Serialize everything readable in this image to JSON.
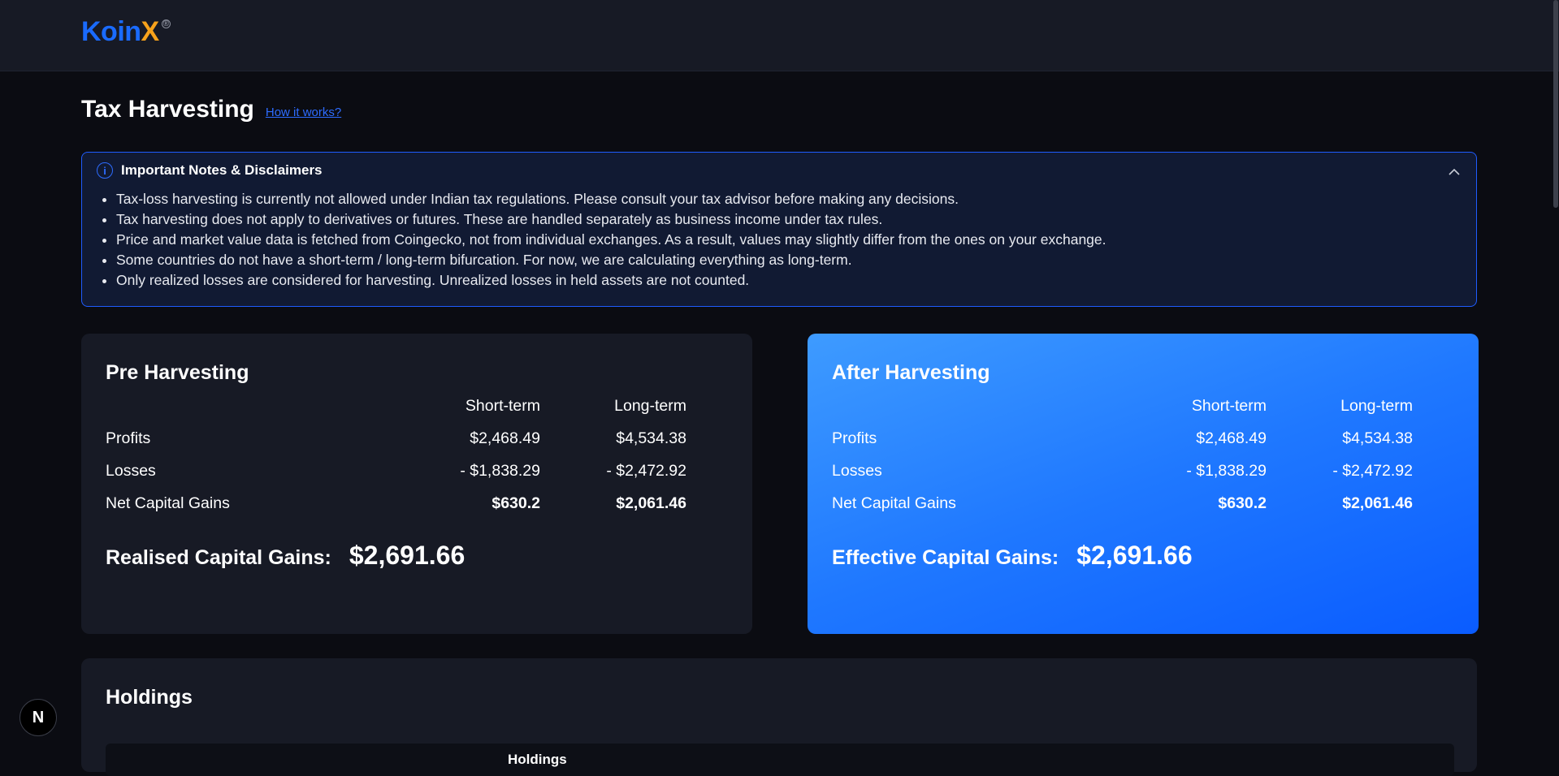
{
  "header": {
    "logo_main": "Koin",
    "logo_accent": "X",
    "logo_mark": "®"
  },
  "page": {
    "title": "Tax Harvesting",
    "how_link": "How it works?"
  },
  "notes": {
    "title": "Important Notes & Disclaimers",
    "items": [
      "Tax-loss harvesting is currently not allowed under Indian tax regulations. Please consult your tax advisor before making any decisions.",
      "Tax harvesting does not apply to derivatives or futures. These are handled separately as business income under tax rules.",
      "Price and market value data is fetched from Coingecko, not from individual exchanges. As a result, values may slightly differ from the ones on your exchange.",
      "Some countries do not have a short-term / long-term bifurcation. For now, we are calculating everything as long-term.",
      "Only realized losses are considered for harvesting. Unrealized losses in held assets are not counted."
    ]
  },
  "pre": {
    "title": "Pre Harvesting",
    "col_short": "Short-term",
    "col_long": "Long-term",
    "profits_label": "Profits",
    "profits_short": "$2,468.49",
    "profits_long": "$4,534.38",
    "losses_label": "Losses",
    "losses_short": "- $1,838.29",
    "losses_long": "- $2,472.92",
    "net_label": "Net Capital Gains",
    "net_short": "$630.2",
    "net_long": "$2,061.46",
    "total_label": "Realised Capital Gains:",
    "total_value": "$2,691.66"
  },
  "post": {
    "title": "After Harvesting",
    "col_short": "Short-term",
    "col_long": "Long-term",
    "profits_label": "Profits",
    "profits_short": "$2,468.49",
    "profits_long": "$4,534.38",
    "losses_label": "Losses",
    "losses_short": "- $1,838.29",
    "losses_long": "- $2,472.92",
    "net_label": "Net Capital Gains",
    "net_short": "$630.2",
    "net_long": "$2,061.46",
    "total_label": "Effective Capital Gains:",
    "total_value": "$2,691.66"
  },
  "holdings": {
    "title": "Holdings",
    "first_column": "Holdings"
  },
  "badge": {
    "letter": "N"
  },
  "colors": {
    "background": "#0b0c12",
    "panel": "#171a25",
    "accent": "#1f5cff",
    "after_card": "#1f78ff",
    "logo_blue": "#1a6bff",
    "logo_orange": "#f7a21b"
  }
}
